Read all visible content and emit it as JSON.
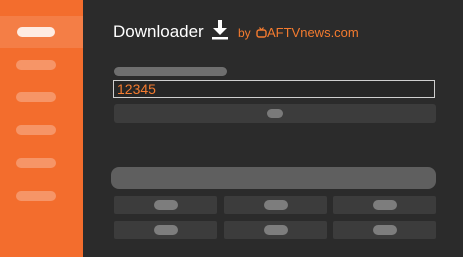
{
  "header": {
    "title": "Downloader",
    "by_label": "by",
    "brand": "AFTVnews.com"
  },
  "colors": {
    "sidebar": "#f36d2d",
    "accent": "#f47b2f",
    "background": "#2b2b2b"
  },
  "icons": {
    "title_icon": "download-icon",
    "brand_icon": "tv-icon"
  },
  "main": {
    "code_input": {
      "value": "12345"
    }
  },
  "sidebar": {
    "item_count": 6,
    "active_index": 0
  }
}
